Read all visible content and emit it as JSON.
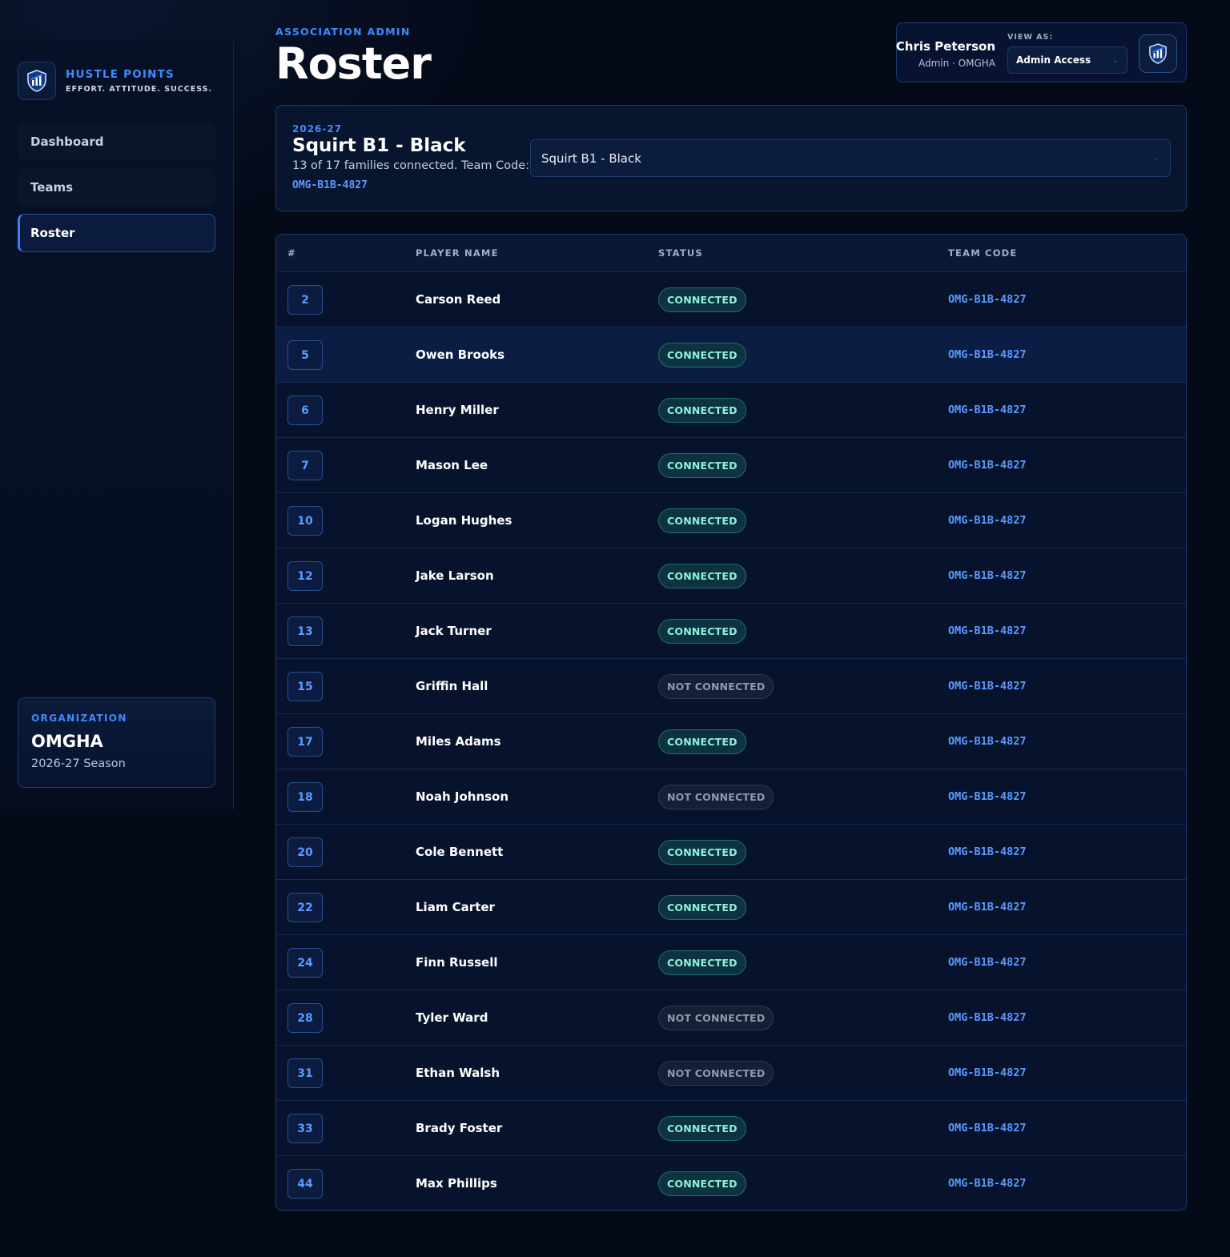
{
  "brand": {
    "name": "HUSTLE POINTS",
    "tagline": "EFFORT. ATTITUDE. SUCCESS.",
    "icon": "shield-chart-icon"
  },
  "nav": [
    {
      "label": "Dashboard",
      "active": false
    },
    {
      "label": "Teams",
      "active": false
    },
    {
      "label": "Roster",
      "active": true
    }
  ],
  "org": {
    "label": "ORGANIZATION",
    "name": "OMGHA",
    "season": "2026-27 Season"
  },
  "header": {
    "eyebrow": "ASSOCIATION ADMIN",
    "title": "Roster"
  },
  "user": {
    "name": "Chris Peterson",
    "role": "Admin · OMGHA",
    "view_as_label": "VIEW AS:",
    "view_as_value": "Admin Access"
  },
  "team": {
    "season": "2026-27",
    "name": "Squirt B1 - Black",
    "summary": "13 of 17 families connected. Team Code:",
    "code": "OMG-B1B-4827",
    "selected": "Squirt B1 - Black"
  },
  "table": {
    "headers": {
      "num": "#",
      "name": "PLAYER NAME",
      "status": "STATUS",
      "code": "TEAM CODE"
    },
    "rows": [
      {
        "num": "2",
        "name": "Carson Reed",
        "status": "CONNECTED",
        "code": "OMG-B1B-4827"
      },
      {
        "num": "5",
        "name": "Owen Brooks",
        "status": "CONNECTED",
        "code": "OMG-B1B-4827"
      },
      {
        "num": "6",
        "name": "Henry Miller",
        "status": "CONNECTED",
        "code": "OMG-B1B-4827"
      },
      {
        "num": "7",
        "name": "Mason Lee",
        "status": "CONNECTED",
        "code": "OMG-B1B-4827"
      },
      {
        "num": "10",
        "name": "Logan Hughes",
        "status": "CONNECTED",
        "code": "OMG-B1B-4827"
      },
      {
        "num": "12",
        "name": "Jake Larson",
        "status": "CONNECTED",
        "code": "OMG-B1B-4827"
      },
      {
        "num": "13",
        "name": "Jack Turner",
        "status": "CONNECTED",
        "code": "OMG-B1B-4827"
      },
      {
        "num": "15",
        "name": "Griffin Hall",
        "status": "NOT CONNECTED",
        "code": "OMG-B1B-4827"
      },
      {
        "num": "17",
        "name": "Miles Adams",
        "status": "CONNECTED",
        "code": "OMG-B1B-4827"
      },
      {
        "num": "18",
        "name": "Noah Johnson",
        "status": "NOT CONNECTED",
        "code": "OMG-B1B-4827"
      },
      {
        "num": "20",
        "name": "Cole Bennett",
        "status": "CONNECTED",
        "code": "OMG-B1B-4827"
      },
      {
        "num": "22",
        "name": "Liam Carter",
        "status": "CONNECTED",
        "code": "OMG-B1B-4827"
      },
      {
        "num": "24",
        "name": "Finn Russell",
        "status": "CONNECTED",
        "code": "OMG-B1B-4827"
      },
      {
        "num": "28",
        "name": "Tyler Ward",
        "status": "NOT CONNECTED",
        "code": "OMG-B1B-4827"
      },
      {
        "num": "31",
        "name": "Ethan Walsh",
        "status": "NOT CONNECTED",
        "code": "OMG-B1B-4827"
      },
      {
        "num": "33",
        "name": "Brady Foster",
        "status": "CONNECTED",
        "code": "OMG-B1B-4827"
      },
      {
        "num": "44",
        "name": "Max Phillips",
        "status": "CONNECTED",
        "code": "OMG-B1B-4827"
      }
    ]
  },
  "colors": {
    "accent": "#3f8bff",
    "background": "#040a18",
    "connected": "#8ff0dc",
    "not_connected": "#8d9ab0"
  }
}
